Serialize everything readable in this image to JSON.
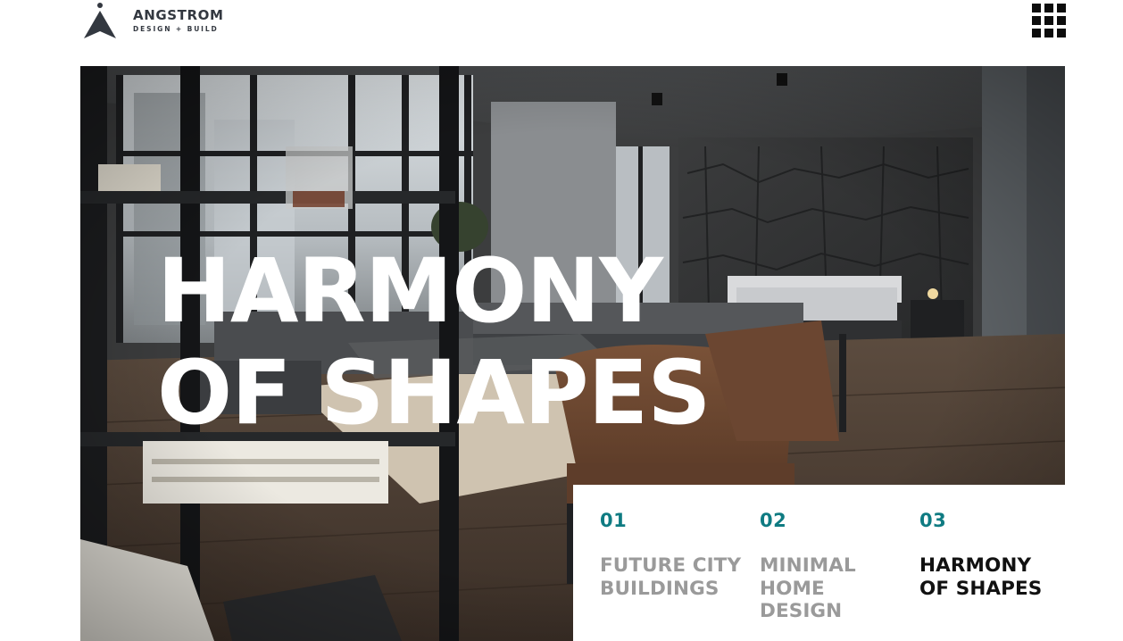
{
  "header": {
    "brand_name": "ANGSTROM",
    "brand_tagline": "DESIGN + BUILD"
  },
  "icons": {
    "logo": "angstrom-a-logo-icon",
    "menu": "grid-menu-icon"
  },
  "hero": {
    "title_line1": "HARMONY",
    "title_line2": "OF SHAPES"
  },
  "slides": [
    {
      "number": "01",
      "label_line1": "FUTURE CITY",
      "label_line2": "BUILDINGS",
      "label_line3": "",
      "active": false
    },
    {
      "number": "02",
      "label_line1": "MINIMAL",
      "label_line2": "HOME",
      "label_line3": "DESIGN",
      "active": false
    },
    {
      "number": "03",
      "label_line1": "HARMONY",
      "label_line2": "OF SHAPES",
      "label_line3": "",
      "active": true
    }
  ],
  "colors": {
    "accent": "#0f7b82",
    "inactive_label": "#9a9a9a",
    "active_label": "#111111",
    "brand_text": "#333840"
  }
}
